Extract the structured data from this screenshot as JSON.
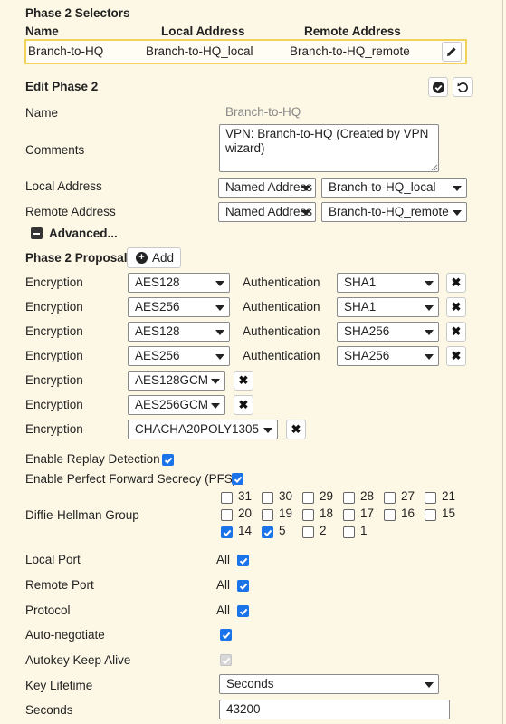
{
  "selectors": {
    "title": "Phase 2 Selectors",
    "col_name": "Name",
    "col_local": "Local Address",
    "col_remote": "Remote Address",
    "row": {
      "name": "Branch-to-HQ",
      "local": "Branch-to-HQ_local",
      "remote": "Branch-to-HQ_remote"
    }
  },
  "edit": {
    "title": "Edit Phase 2",
    "name_label": "Name",
    "name_value": "Branch-to-HQ",
    "comments_label": "Comments",
    "comments_value": "VPN: Branch-to-HQ (Created by VPN wizard)",
    "local_label": "Local Address",
    "local_type": "Named Address",
    "local_value": "Branch-to-HQ_local",
    "remote_label": "Remote Address",
    "remote_type": "Named Address",
    "remote_value": "Branch-to-HQ_remote",
    "advanced_label": "Advanced..."
  },
  "proposal": {
    "title": "Phase 2 Proposal",
    "add_label": "Add",
    "enc_label": "Encryption",
    "auth_label": "Authentication",
    "rows": [
      {
        "enc": "AES128",
        "auth": "SHA1"
      },
      {
        "enc": "AES256",
        "auth": "SHA1"
      },
      {
        "enc": "AES128",
        "auth": "SHA256"
      },
      {
        "enc": "AES256",
        "auth": "SHA256"
      },
      {
        "enc": "AES128GCM"
      },
      {
        "enc": "AES256GCM"
      },
      {
        "enc": "CHACHA20POLY1305"
      }
    ]
  },
  "options": {
    "replay_label": "Enable Replay Detection",
    "replay_checked": true,
    "pfs_label": "Enable Perfect Forward Secrecy (PFS)",
    "pfs_checked": true,
    "dh_label": "Diffie-Hellman Group",
    "dh_groups": [
      {
        "value": "31",
        "checked": false
      },
      {
        "value": "30",
        "checked": false
      },
      {
        "value": "29",
        "checked": false
      },
      {
        "value": "28",
        "checked": false
      },
      {
        "value": "27",
        "checked": false
      },
      {
        "value": "21",
        "checked": false
      },
      {
        "value": "20",
        "checked": false
      },
      {
        "value": "19",
        "checked": false
      },
      {
        "value": "18",
        "checked": false
      },
      {
        "value": "17",
        "checked": false
      },
      {
        "value": "16",
        "checked": false
      },
      {
        "value": "15",
        "checked": false
      },
      {
        "value": "14",
        "checked": true
      },
      {
        "value": "5",
        "checked": true
      },
      {
        "value": "2",
        "checked": false
      },
      {
        "value": "1",
        "checked": false
      }
    ],
    "local_port_label": "Local Port",
    "remote_port_label": "Remote Port",
    "protocol_label": "Protocol",
    "all_label": "All",
    "autoneg_label": "Auto-negotiate",
    "keepalive_label": "Autokey Keep Alive",
    "key_lifetime_label": "Key Lifetime",
    "key_lifetime_value": "Seconds",
    "seconds_label": "Seconds",
    "seconds_value": "43200"
  },
  "colors": {
    "accent": "#1a73e8",
    "highlight_border": "#f2d35a",
    "background": "#fdf8e6"
  },
  "icons": [
    "pencil-icon",
    "check-circle-icon",
    "undo-icon",
    "plus-circle-icon",
    "minus-square-icon",
    "close-icon",
    "caret-down-icon",
    "checkmark-icon"
  ]
}
